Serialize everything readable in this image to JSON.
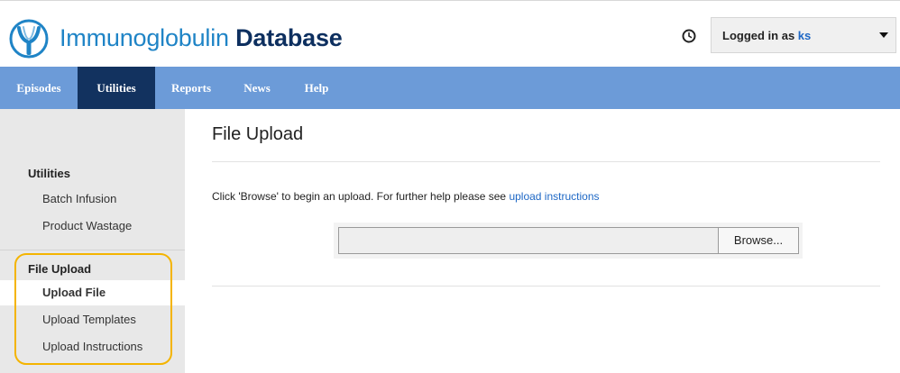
{
  "header": {
    "title_light": "Immunoglobulin ",
    "title_bold": "Database",
    "user_prefix": "Logged in as ",
    "user_name": "ks"
  },
  "nav": {
    "items": [
      {
        "label": "Episodes",
        "active": false
      },
      {
        "label": "Utilities",
        "active": true
      },
      {
        "label": "Reports",
        "active": false
      },
      {
        "label": "News",
        "active": false
      },
      {
        "label": "Help",
        "active": false
      }
    ]
  },
  "sidebar": {
    "sections": [
      {
        "heading": "Utilities",
        "items": [
          {
            "label": "Batch Infusion",
            "active": false
          },
          {
            "label": "Product Wastage",
            "active": false
          }
        ]
      },
      {
        "heading": "File Upload",
        "items": [
          {
            "label": "Upload File",
            "active": true
          },
          {
            "label": "Upload Templates",
            "active": false
          },
          {
            "label": "Upload Instructions",
            "active": false
          }
        ]
      }
    ]
  },
  "main": {
    "title": "File Upload",
    "instruction_text": "Click 'Browse' to begin an upload. For further help please see ",
    "instruction_link": "upload instructions",
    "file_value": "",
    "browse_label": "Browse..."
  },
  "colors": {
    "nav_bg": "#6c9bd8",
    "nav_active": "#12325f",
    "brand_blue": "#1f84c6",
    "brand_dark": "#0d2f5f",
    "link": "#1d67c5",
    "highlight": "#f4b400"
  },
  "icons": {
    "logo": "antibody-logo-icon",
    "clock": "clock-icon",
    "dropdown": "chevron-down-icon"
  }
}
